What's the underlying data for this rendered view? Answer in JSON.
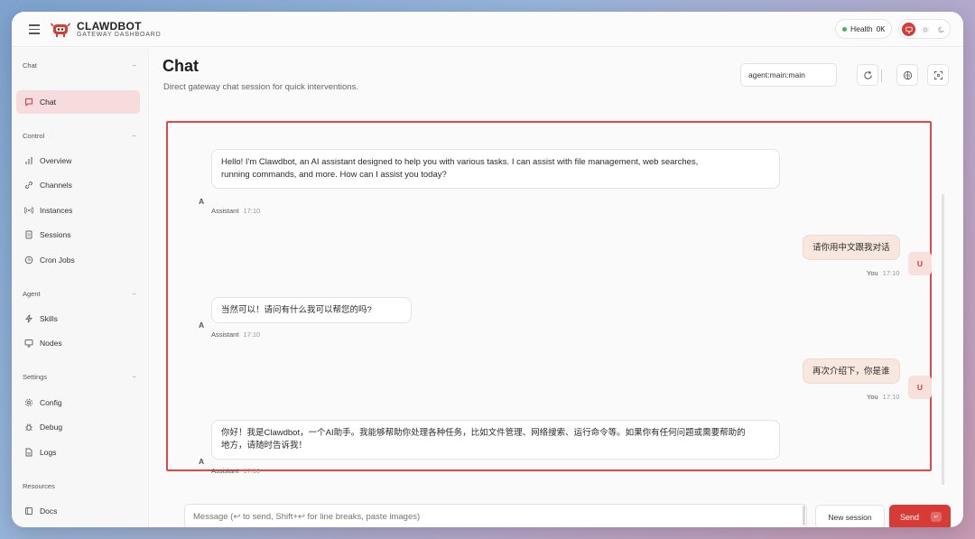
{
  "brand": {
    "name": "CLAWDBOT",
    "subtitle": "GATEWAY DASHBOARD"
  },
  "health": {
    "label": "Health",
    "status": "OK",
    "status_color": "#3fb950"
  },
  "accent_color": "#d63b35",
  "sidebar": {
    "sections": [
      {
        "label": "Chat",
        "items": [
          {
            "label": "Chat",
            "icon": "chat-bubble-icon",
            "active": true
          }
        ]
      },
      {
        "label": "Control",
        "items": [
          {
            "label": "Overview",
            "icon": "bar-chart-icon"
          },
          {
            "label": "Channels",
            "icon": "link-icon"
          },
          {
            "label": "Instances",
            "icon": "radio-icon"
          },
          {
            "label": "Sessions",
            "icon": "document-icon"
          },
          {
            "label": "Cron Jobs",
            "icon": "clock-icon"
          }
        ]
      },
      {
        "label": "Agent",
        "items": [
          {
            "label": "Skills",
            "icon": "lightning-icon"
          },
          {
            "label": "Nodes",
            "icon": "monitor-icon"
          }
        ]
      },
      {
        "label": "Settings",
        "items": [
          {
            "label": "Config",
            "icon": "gear-icon"
          },
          {
            "label": "Debug",
            "icon": "bug-icon"
          },
          {
            "label": "Logs",
            "icon": "file-icon"
          }
        ]
      },
      {
        "label": "Resources",
        "items": [
          {
            "label": "Docs",
            "icon": "book-icon"
          }
        ]
      }
    ]
  },
  "main": {
    "title": "Chat",
    "subtitle": "Direct gateway chat session for quick interventions.",
    "session_key": "agent:main:main"
  },
  "messages": [
    {
      "role": "assistant",
      "avatar": "A",
      "sender": "Assistant",
      "time": "17:10",
      "lines": [
        "Hello! I'm Clawdbot, an AI assistant designed to help you with various tasks. I can assist with file management, web searches,",
        "running commands, and more. How can I assist you today?"
      ]
    },
    {
      "role": "user",
      "avatar": "U",
      "sender": "You",
      "time": "17:10",
      "lines": [
        "请你用中文跟我对话"
      ]
    },
    {
      "role": "assistant",
      "avatar": "A",
      "sender": "Assistant",
      "time": "17:10",
      "lines": [
        "当然可以！请问有什么我可以帮您的吗?"
      ]
    },
    {
      "role": "user",
      "avatar": "U",
      "sender": "You",
      "time": "17:10",
      "lines": [
        "再次介绍下，你是谁"
      ]
    },
    {
      "role": "assistant",
      "avatar": "A",
      "sender": "Assistant",
      "time": "17:10",
      "lines": [
        "你好！我是Clawdbot，一个AI助手。我能够帮助你处理各种任务，比如文件管理、网络搜索、运行命令等。如果你有任何问题或需要帮助的",
        "地方，请随时告诉我！"
      ]
    }
  ],
  "composer": {
    "placeholder": "Message (↩ to send, Shift+↩ for line breaks, paste images)",
    "new_session_label": "New session",
    "send_label": "Send",
    "send_key_hint": "↵"
  }
}
